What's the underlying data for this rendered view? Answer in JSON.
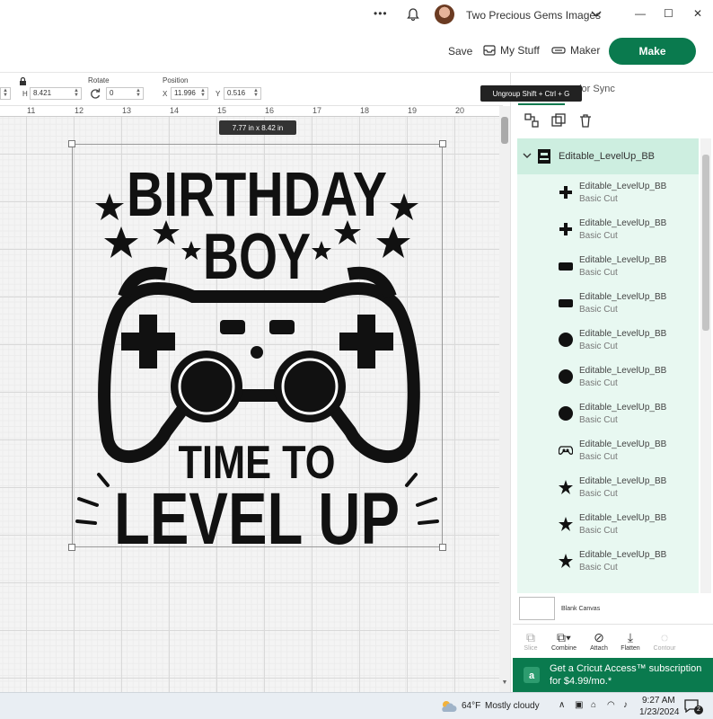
{
  "window": {
    "account_name": "Two Precious Gems Images",
    "more_glyph": "•••",
    "minimize_glyph": "—",
    "maximize_glyph": "☐",
    "close_glyph": "✕"
  },
  "header": {
    "save_label": "Save",
    "mystuff_label": "My Stuff",
    "maker_label": "Maker",
    "make_label": "Make"
  },
  "toolbar": {
    "h_label": "H",
    "height_value": "8.421",
    "rotate_label": "Rotate",
    "rotate_value": "0",
    "position_label": "Position",
    "x_label": "X",
    "x_value": "11.996",
    "y_label": "Y",
    "y_value": "0.516"
  },
  "ruler": {
    "ticks": [
      "11",
      "12",
      "13",
      "14",
      "15",
      "16",
      "17",
      "18",
      "19",
      "20"
    ]
  },
  "canvas": {
    "size_badge": "7.77  in x 8.42  in",
    "design": {
      "line1": "BIRTHDAY",
      "line2": "BOY",
      "line3": "TIME TO",
      "line4": "LEVEL UP"
    }
  },
  "panel": {
    "tooltip": "Ungroup Shift + Ctrl + G",
    "tab_partial": "olor Sync",
    "group_name": "Editable_LevelUp_BB",
    "layers": [
      {
        "name": "Editable_LevelUp_BB",
        "op": "Basic Cut",
        "icon": "plus-icon"
      },
      {
        "name": "Editable_LevelUp_BB",
        "op": "Basic Cut",
        "icon": "plus-icon"
      },
      {
        "name": "Editable_LevelUp_BB",
        "op": "Basic Cut",
        "icon": "rounded-rect-icon"
      },
      {
        "name": "Editable_LevelUp_BB",
        "op": "Basic Cut",
        "icon": "rounded-rect-icon"
      },
      {
        "name": "Editable_LevelUp_BB",
        "op": "Basic Cut",
        "icon": "circle-icon"
      },
      {
        "name": "Editable_LevelUp_BB",
        "op": "Basic Cut",
        "icon": "circle-icon"
      },
      {
        "name": "Editable_LevelUp_BB",
        "op": "Basic Cut",
        "icon": "circle-icon"
      },
      {
        "name": "Editable_LevelUp_BB",
        "op": "Basic Cut",
        "icon": "gamepad-icon"
      },
      {
        "name": "Editable_LevelUp_BB",
        "op": "Basic Cut",
        "icon": "star-icon"
      },
      {
        "name": "Editable_LevelUp_BB",
        "op": "Basic Cut",
        "icon": "star-icon"
      },
      {
        "name": "Editable_LevelUp_BB",
        "op": "Basic Cut",
        "icon": "star-icon"
      }
    ],
    "blank_canvas_label": "Blank Canvas",
    "tools": {
      "slice": "Slice",
      "combine": "Combine",
      "attach": "Attach",
      "flatten": "Flatten",
      "contour": "Contour"
    },
    "access_banner": "Get a Cricut Access™ subscription for $4.99/mo.*"
  },
  "taskbar": {
    "weather_temp": "64°F",
    "weather_desc": "Mostly cloudy",
    "time": "9:27 AM",
    "date": "1/23/2024",
    "notif_count": "2"
  },
  "colors": {
    "accent": "#0a7a4e",
    "layer_group_bg": "#cdeee0",
    "layer_list_bg": "#e8f8f1"
  }
}
